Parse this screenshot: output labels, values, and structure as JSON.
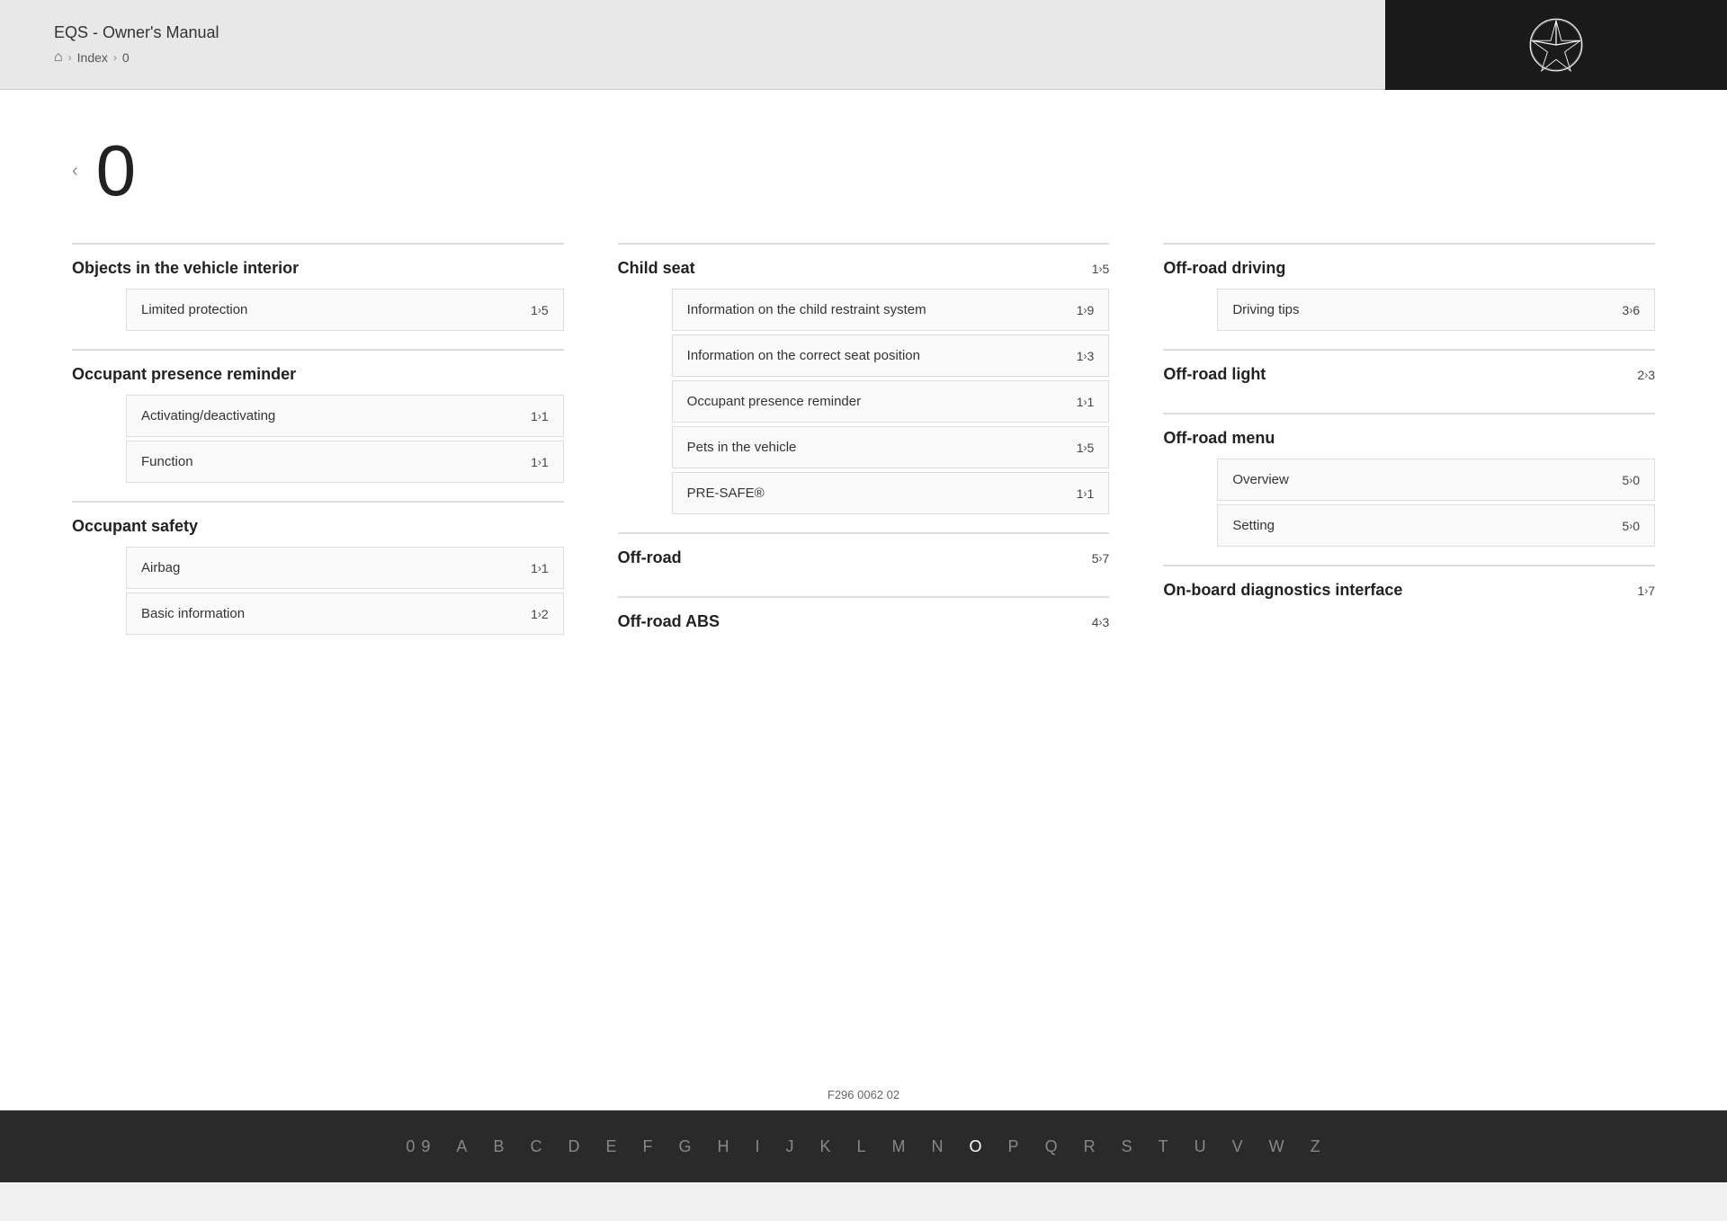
{
  "header": {
    "title": "EQS - Owner's Manual",
    "breadcrumb": {
      "home_icon": "⌂",
      "sep1": ">",
      "index_label": "Index",
      "sep2": ">",
      "current": "0"
    }
  },
  "page": {
    "nav_left": "‹",
    "index_letter": "0"
  },
  "columns": [
    {
      "sections": [
        {
          "id": "objects-in-vehicle-interior",
          "title": "Objects in the vehicle interior",
          "is_bold_link": false,
          "entries": [
            {
              "label": "Limited protection",
              "page": "1",
              "page_suffix": "5"
            }
          ]
        },
        {
          "id": "occupant-presence-reminder",
          "title": "Occupant presence reminder",
          "is_bold_link": false,
          "entries": [
            {
              "label": "Activating/deactivating",
              "page": "1",
              "page_suffix": "1"
            },
            {
              "label": "Function",
              "page": "1",
              "page_suffix": "1"
            }
          ]
        },
        {
          "id": "occupant-safety",
          "title": "Occupant safety",
          "is_bold_link": false,
          "entries": [
            {
              "label": "Airbag",
              "page": "1",
              "page_suffix": "1"
            },
            {
              "label": "Basic information",
              "page": "1",
              "page_suffix": "2"
            }
          ]
        }
      ]
    },
    {
      "sections": [
        {
          "id": "child-seat",
          "title": "Child seat",
          "is_bold_link": true,
          "page": "1",
          "page_suffix": "5",
          "entries": [
            {
              "label": "Information on the child restraint system",
              "page": "1",
              "page_suffix": "9"
            },
            {
              "label": "Information on the correct seat position",
              "page": "1",
              "page_suffix": "3"
            },
            {
              "label": "Occupant presence reminder",
              "page": "1",
              "page_suffix": "1"
            },
            {
              "label": "Pets in the vehicle",
              "page": "1",
              "page_suffix": "5"
            },
            {
              "label": "PRE-SAFE®",
              "page": "1",
              "page_suffix": "1"
            }
          ]
        },
        {
          "id": "off-road",
          "title": "Off-road",
          "is_bold_link": true,
          "page": "5",
          "page_suffix": "7",
          "entries": []
        },
        {
          "id": "off-road-abs",
          "title": "Off-road ABS",
          "is_bold_link": true,
          "page": "4",
          "page_suffix": "3",
          "entries": []
        }
      ]
    },
    {
      "sections": [
        {
          "id": "off-road-driving",
          "title": "Off-road driving",
          "is_bold_link": false,
          "entries": [
            {
              "label": "Driving tips",
              "page": "3",
              "page_suffix": "6"
            }
          ]
        },
        {
          "id": "off-road-light",
          "title": "Off-road light",
          "is_bold_link": true,
          "page": "2",
          "page_suffix": "3",
          "entries": []
        },
        {
          "id": "off-road-menu",
          "title": "Off-road menu",
          "is_bold_link": false,
          "entries": [
            {
              "label": "Overview",
              "page": "5",
              "page_suffix": "0"
            },
            {
              "label": "Setting",
              "page": "5",
              "page_suffix": "0"
            }
          ]
        },
        {
          "id": "on-board-diagnostics-interface",
          "title": "On-board diagnostics interface",
          "is_bold_link": true,
          "page": "1",
          "page_suffix": "7",
          "entries": []
        }
      ]
    }
  ],
  "alphabet": {
    "items": [
      "0 9",
      "A",
      "B",
      "C",
      "D",
      "E",
      "F",
      "G",
      "H",
      "I",
      "J",
      "K",
      "L",
      "M",
      "N",
      "O",
      "P",
      "Q",
      "R",
      "S",
      "T",
      "U",
      "V",
      "W",
      "Z"
    ],
    "active": "O"
  },
  "footer": {
    "code": "F296 0062 02"
  }
}
